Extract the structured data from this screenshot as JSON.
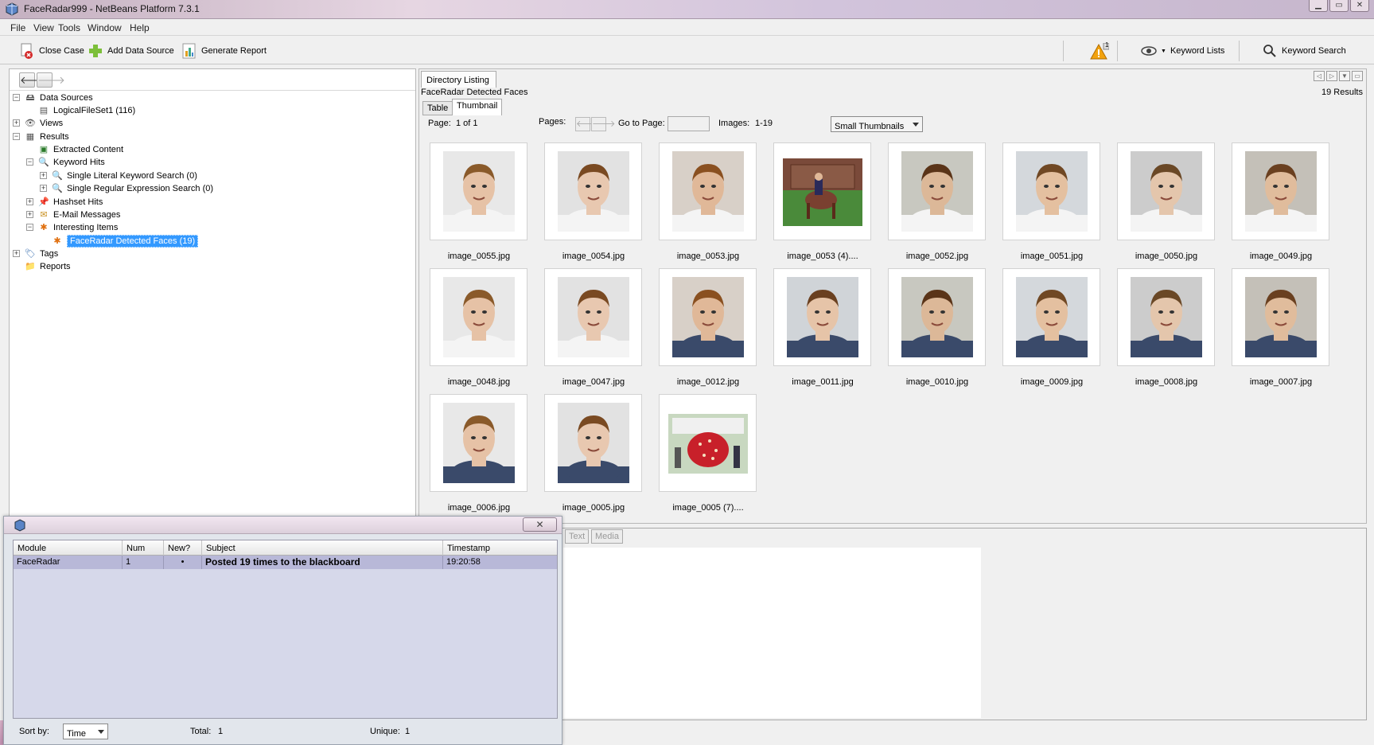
{
  "window": {
    "title": "FaceRadar999 - NetBeans Platform 7.3.1"
  },
  "menu": [
    "File",
    "View",
    "Tools",
    "Window",
    "Help"
  ],
  "toolbar": {
    "close_case": "Close Case",
    "add_data_source": "Add Data Source",
    "generate_report": "Generate Report",
    "warning_count": "1",
    "keyword_lists": "Keyword Lists",
    "keyword_search": "Keyword Search"
  },
  "tree": [
    {
      "label": "Data Sources",
      "toggle": "−",
      "icon": "data-sources-icon"
    },
    {
      "label": "LogicalFileSet1 (116)",
      "toggle": "",
      "icon": "logical-fileset-icon"
    },
    {
      "label": "Views",
      "toggle": "+",
      "icon": "views-icon"
    },
    {
      "label": "Results",
      "toggle": "−",
      "icon": "results-icon"
    },
    {
      "label": "Extracted Content",
      "toggle": "",
      "icon": "extracted-content-icon"
    },
    {
      "label": "Keyword Hits",
      "toggle": "−",
      "icon": "keyword-hits-icon"
    },
    {
      "label": "Single Literal Keyword Search (0)",
      "toggle": "+",
      "icon": "magnifier-icon"
    },
    {
      "label": "Single Regular Expression Search (0)",
      "toggle": "+",
      "icon": "magnifier-icon"
    },
    {
      "label": "Hashset Hits",
      "toggle": "+",
      "icon": "hashset-icon"
    },
    {
      "label": "E-Mail Messages",
      "toggle": "+",
      "icon": "email-icon"
    },
    {
      "label": "Interesting Items",
      "toggle": "−",
      "icon": "interesting-items-icon"
    },
    {
      "label": "FaceRadar Detected Faces (19)",
      "toggle": "",
      "icon": "interesting-items-icon"
    },
    {
      "label": "Tags",
      "toggle": "+",
      "icon": "tags-icon"
    },
    {
      "label": "Reports",
      "toggle": "",
      "icon": "reports-icon"
    }
  ],
  "listing": {
    "tab": "Directory Listing",
    "heading": "FaceRadar Detected Faces",
    "results": "19  Results",
    "tabs": [
      "Table",
      "Thumbnail"
    ],
    "page_label": "Page:",
    "page_value": "1 of 1",
    "pages_label": "Pages:",
    "goto_label": "Go to Page:",
    "goto_value": "",
    "images_label": "Images:",
    "images_value": "1-19",
    "size_option": "Small Thumbnails"
  },
  "thumbs": [
    {
      "name": "image_0055.jpg",
      "kind": "portrait"
    },
    {
      "name": "image_0054.jpg",
      "kind": "portrait"
    },
    {
      "name": "image_0053.jpg",
      "kind": "portrait"
    },
    {
      "name": "image_0053 (4)....",
      "kind": "landscape"
    },
    {
      "name": "image_0052.jpg",
      "kind": "portrait"
    },
    {
      "name": "image_0051.jpg",
      "kind": "portrait"
    },
    {
      "name": "image_0050.jpg",
      "kind": "portrait"
    },
    {
      "name": "image_0049.jpg",
      "kind": "portrait"
    },
    {
      "name": "image_0048.jpg",
      "kind": "portrait"
    },
    {
      "name": "image_0047.jpg",
      "kind": "portrait"
    },
    {
      "name": "image_0012.jpg",
      "kind": "portrait"
    },
    {
      "name": "image_0011.jpg",
      "kind": "portrait"
    },
    {
      "name": "image_0010.jpg",
      "kind": "portrait"
    },
    {
      "name": "image_0009.jpg",
      "kind": "portrait"
    },
    {
      "name": "image_0008.jpg",
      "kind": "portrait"
    },
    {
      "name": "image_0007.jpg",
      "kind": "portrait"
    },
    {
      "name": "image_0006.jpg",
      "kind": "portrait"
    },
    {
      "name": "image_0005.jpg",
      "kind": "portrait"
    },
    {
      "name": "image_0005 (7)....",
      "kind": "landscape-small"
    }
  ],
  "content_tabs": [
    "Text",
    "Media"
  ],
  "blackboard": {
    "columns": [
      "Module",
      "Num",
      "New?",
      "Subject",
      "Timestamp"
    ],
    "rows": [
      {
        "module": "FaceRadar",
        "num": "1",
        "new": "•",
        "subject": "Posted 19 times to the blackboard",
        "timestamp": "19:20:58"
      }
    ],
    "sort_label": "Sort by:",
    "sort_value": "Time",
    "total_label": "Total:",
    "total_value": "1",
    "unique_label": "Unique:",
    "unique_value": "1"
  }
}
